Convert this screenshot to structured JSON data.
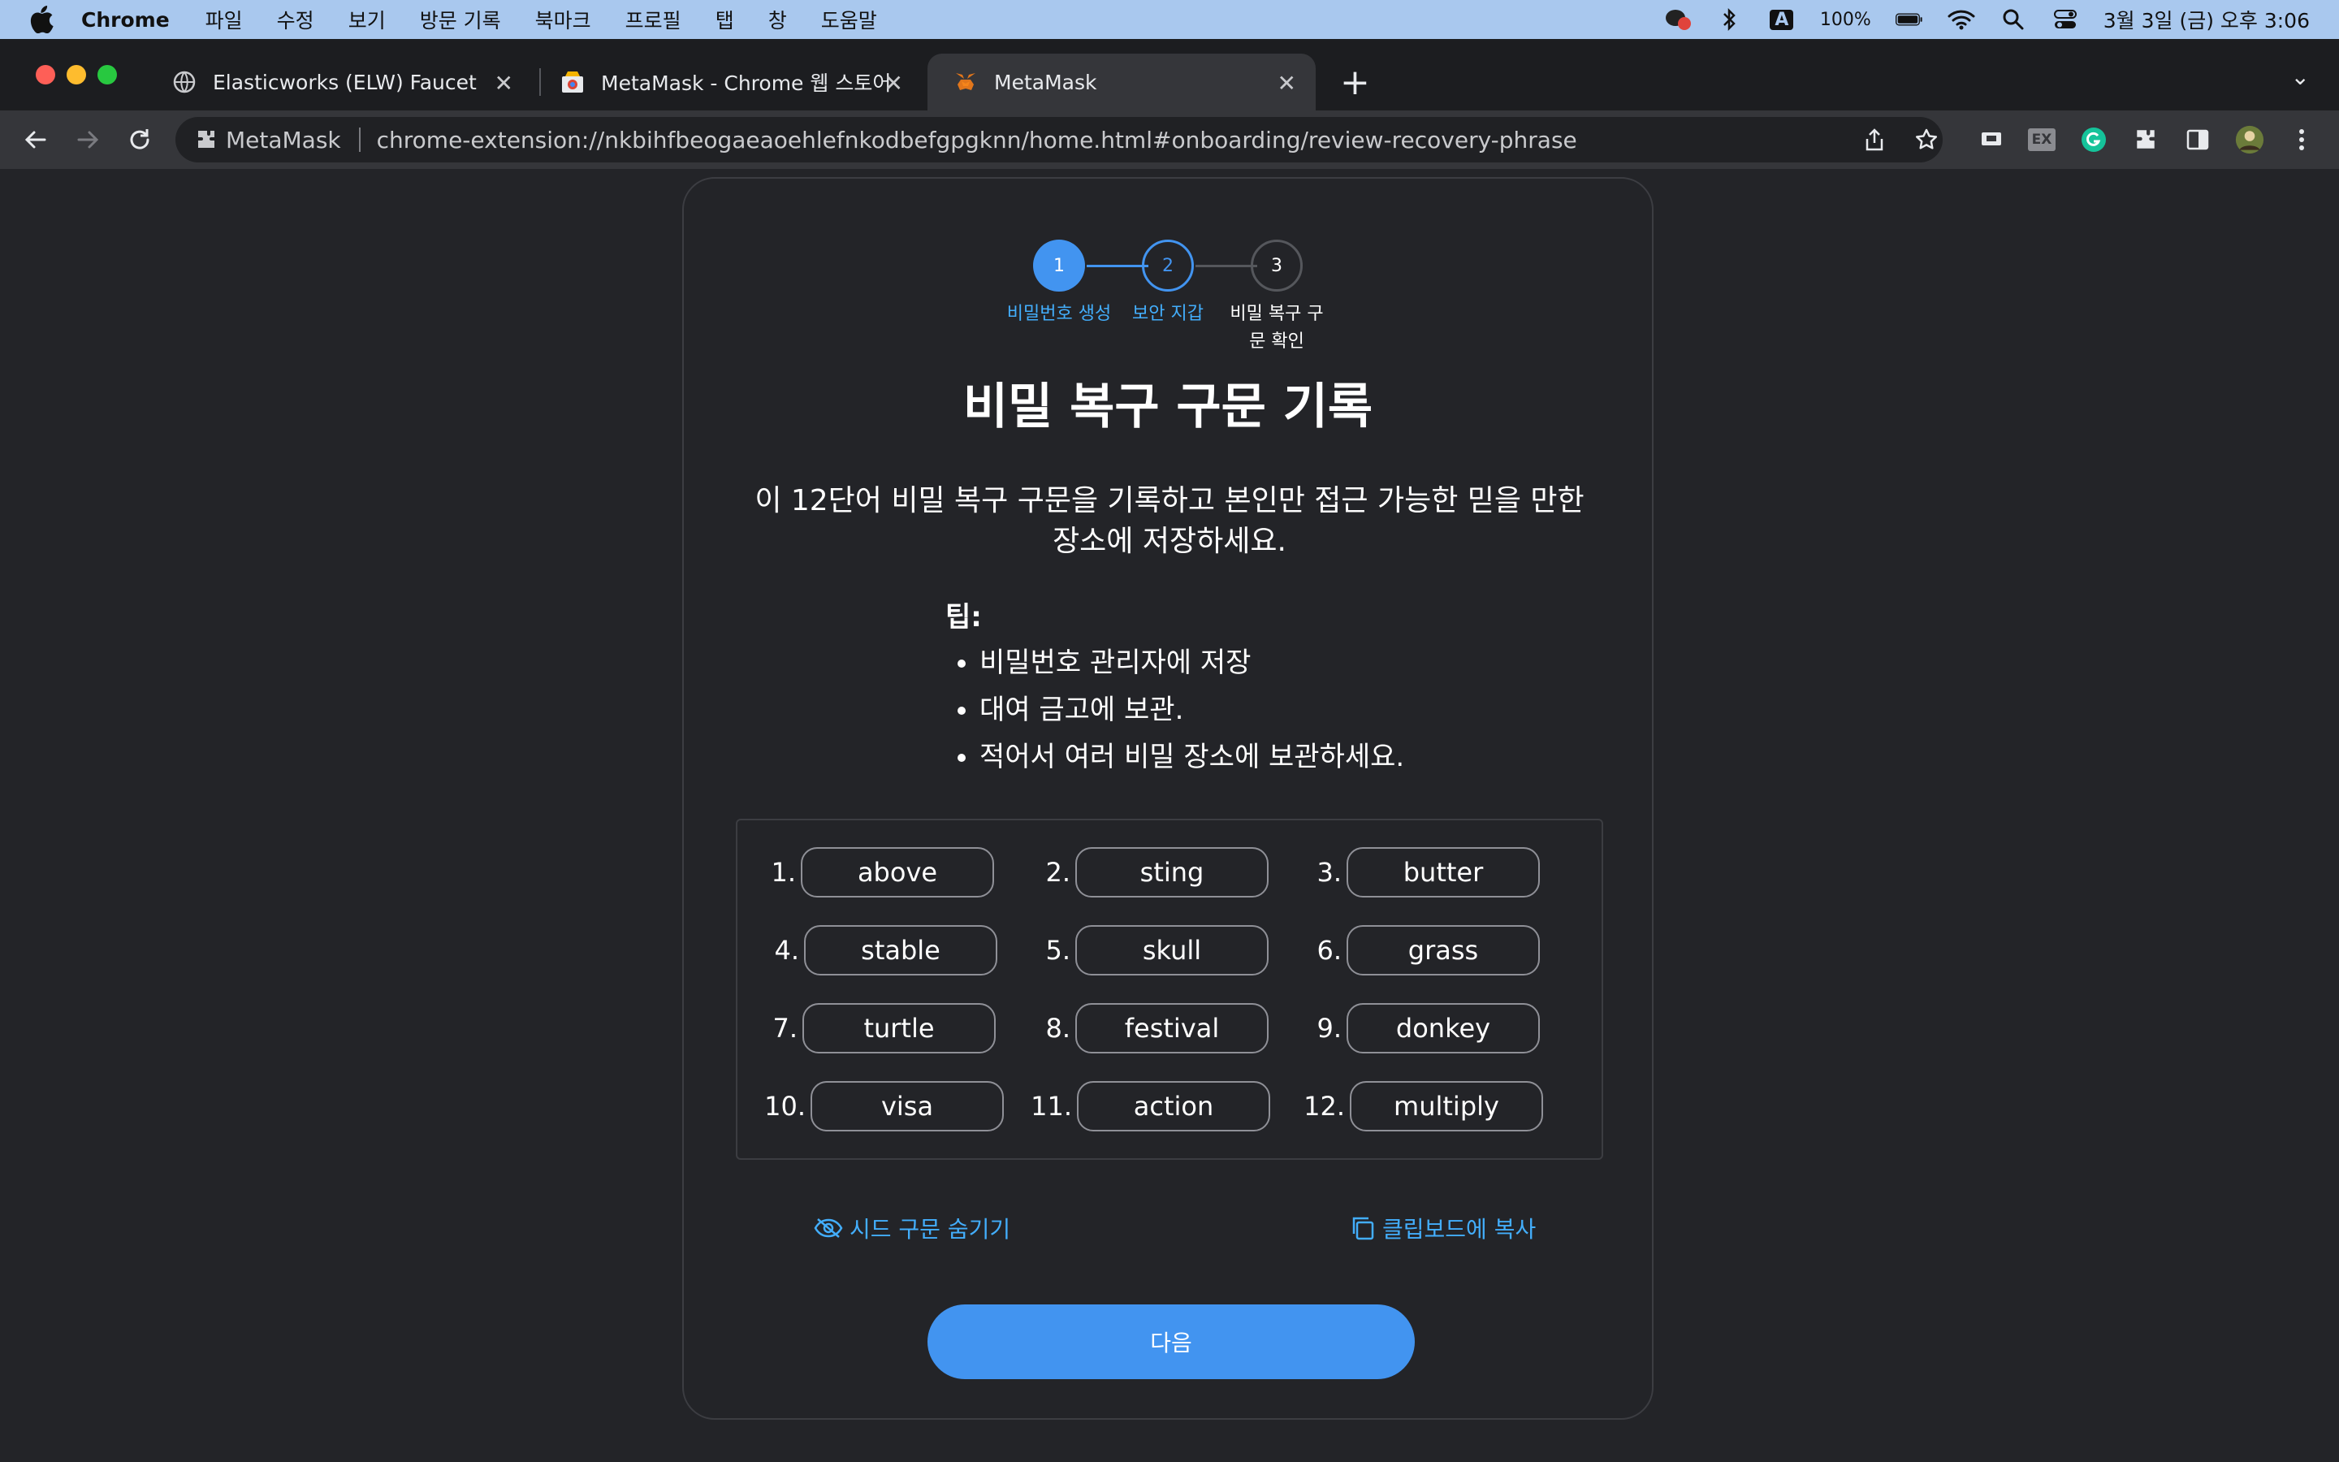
{
  "menubar": {
    "app_name": "Chrome",
    "items": [
      "파일",
      "수정",
      "보기",
      "방문 기록",
      "북마크",
      "프로필",
      "탭",
      "창",
      "도움말"
    ],
    "battery": "100%",
    "datetime": "3월 3일 (금) 오후 3:06",
    "input_indicator": "A"
  },
  "tabs": [
    {
      "title": "Elasticworks (ELW) Faucet",
      "icon": "globe-icon",
      "active": false
    },
    {
      "title": "MetaMask - Chrome 웹 스토어",
      "icon": "chrome-web-store-icon",
      "active": false
    },
    {
      "title": "MetaMask",
      "icon": "metamask-fox-icon",
      "active": true
    }
  ],
  "omnibox": {
    "chip_label": "MetaMask",
    "url": "chrome-extension://nkbihfbeogaeaoehlefnkodbefgpgknn/home.html#onboarding/review-recovery-phrase"
  },
  "stepper": {
    "steps": [
      {
        "number": "1",
        "label": "비밀번호 생성",
        "state": "complete"
      },
      {
        "number": "2",
        "label": "보안 지갑",
        "state": "current"
      },
      {
        "number": "3",
        "label": "비밀 복구 구\n문 확인",
        "state": "upcoming"
      }
    ]
  },
  "page": {
    "title": "비밀 복구 구문 기록",
    "description": "이 12단어 비밀 복구 구문을 기록하고 본인만 접근 가능한 믿을 만한 장소에 저장하세요.",
    "tips_title": "팁:",
    "tips": [
      "비밀번호 관리자에 저장",
      "대여 금고에 보관.",
      "적어서 여러 비밀 장소에 보관하세요."
    ],
    "words": [
      {
        "num": "1.",
        "word": "above"
      },
      {
        "num": "2.",
        "word": "sting"
      },
      {
        "num": "3.",
        "word": "butter"
      },
      {
        "num": "4.",
        "word": "stable"
      },
      {
        "num": "5.",
        "word": "skull"
      },
      {
        "num": "6.",
        "word": "grass"
      },
      {
        "num": "7.",
        "word": "turtle"
      },
      {
        "num": "8.",
        "word": "festival"
      },
      {
        "num": "9.",
        "word": "donkey"
      },
      {
        "num": "10.",
        "word": "visa"
      },
      {
        "num": "11.",
        "word": "action"
      },
      {
        "num": "12.",
        "word": "multiply"
      }
    ],
    "hide_seed_label": "시드 구문 숨기기",
    "copy_label": "클립보드에 복사",
    "next_label": "다음"
  },
  "colors": {
    "accent": "#4294f0",
    "link": "#43aefc",
    "background": "#232428"
  }
}
